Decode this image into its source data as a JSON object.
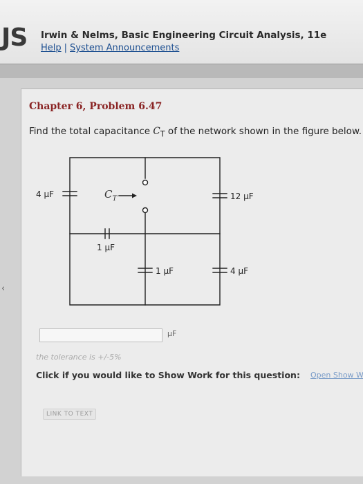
{
  "header": {
    "logo_fragment": "JS",
    "book_title": "Irwin & Nelms, Basic Engineering Circuit Analysis, 11e",
    "links": [
      "Help",
      "System Announcements"
    ],
    "separator": "|"
  },
  "problem": {
    "chapter_title": "Chapter 6, Problem 6.47",
    "question_prefix": "Find the total capacitance ",
    "question_symbol": "C",
    "question_subscript": "T",
    "question_suffix": " of the network shown in the figure below."
  },
  "circuit": {
    "labels": {
      "c_left": "4 μF",
      "c_total_main": "C",
      "c_total_sub": "T",
      "c_right_top": "12 μF",
      "c_middle": "1 μF",
      "c_inner": "1 μF",
      "c_right_bottom": "4 μF"
    }
  },
  "answer": {
    "input_value": "",
    "unit": "μF",
    "tolerance_text": "the tolerance is +/-5%"
  },
  "show_work": {
    "prompt": "Click if you would like to Show Work for this question:",
    "link": "Open Show Work"
  },
  "link_to_text": "LINK TO TEXT",
  "colors": {
    "chapter_title": "#8a2424",
    "link": "#1d4f91",
    "panel_background": "#ececec"
  }
}
